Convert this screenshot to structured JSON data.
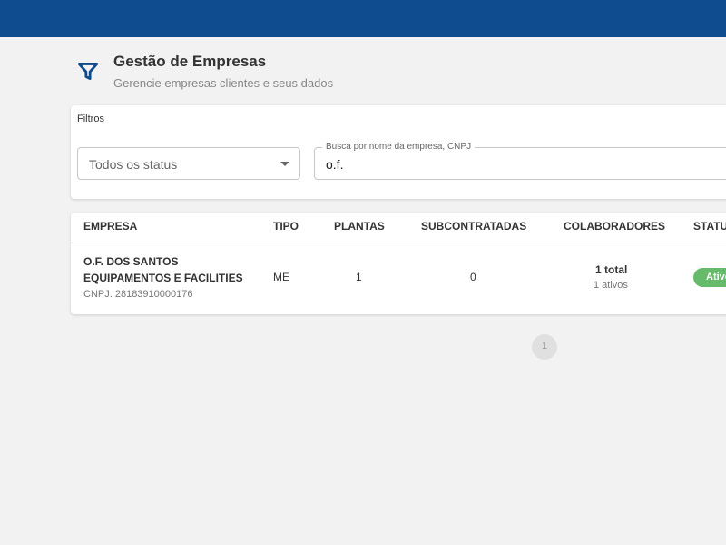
{
  "header": {
    "title": "Gestão de Empresas",
    "subtitle": "Gerencie empresas clientes e seus dados"
  },
  "filters": {
    "label": "Filtros",
    "status_select": {
      "value": "Todos os status"
    },
    "search": {
      "label": "Busca por nome da empresa, CNPJ",
      "value": "o.f."
    }
  },
  "table": {
    "headers": {
      "empresa": "EMPRESA",
      "tipo": "TIPO",
      "plantas": "PLANTAS",
      "subcontratadas": "SUBCONTRATADAS",
      "colaboradores": "COLABORADORES",
      "status": "STATUS"
    },
    "rows": [
      {
        "name_line1": "O.F. DOS SANTOS",
        "name_line2": "EQUIPAMENTOS E FACILITIES",
        "cnpj": "CNPJ: 28183910000176",
        "tipo": "ME",
        "plantas": "1",
        "subcontratadas": "0",
        "colaboradores_total": "1 total",
        "colaboradores_ativos": "1 ativos",
        "status": "Ativo"
      }
    ]
  },
  "pagination": {
    "current_page": "1"
  },
  "colors": {
    "topbar": "#0f4c8f",
    "status_active": "#66bb6a",
    "filter_icon": "#0f4c8f"
  },
  "icons": {
    "header_icon": "filter-icon"
  }
}
